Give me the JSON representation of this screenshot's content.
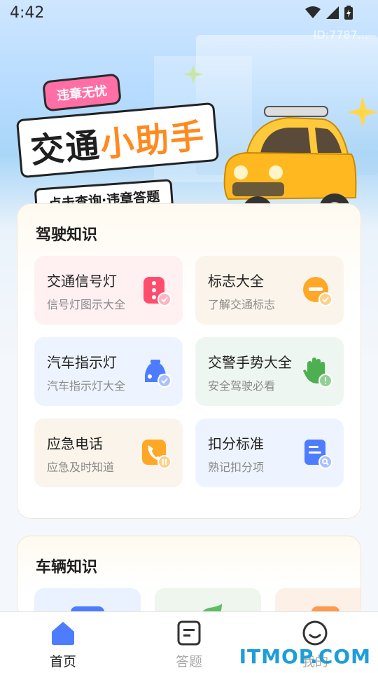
{
  "status": {
    "time": "4:42"
  },
  "user": {
    "id_text": "ID:7787..."
  },
  "banner": {
    "badge": "违章无忧",
    "title_main": "交通",
    "title_accent": "小助手",
    "subtitle": "点击查询·违章答题"
  },
  "driving": {
    "title": "驾驶知识",
    "items": [
      {
        "title": "交通信号灯",
        "subtitle": "信号灯图示大全",
        "icon": "traffic-light-icon"
      },
      {
        "title": "标志大全",
        "subtitle": "了解交通标志",
        "icon": "sign-icon"
      },
      {
        "title": "汽车指示灯",
        "subtitle": "汽车指示灯大全",
        "icon": "car-indicator-icon"
      },
      {
        "title": "交警手势大全",
        "subtitle": "安全驾驶必看",
        "icon": "hand-gesture-icon"
      },
      {
        "title": "应急电话",
        "subtitle": "应急及时知道",
        "icon": "phone-icon"
      },
      {
        "title": "扣分标准",
        "subtitle": "熟记扣分项",
        "icon": "document-search-icon"
      }
    ]
  },
  "vehicle": {
    "title": "车辆知识"
  },
  "tabs": [
    {
      "label": "首页",
      "icon": "home-icon",
      "active": true
    },
    {
      "label": "答题",
      "icon": "quiz-icon",
      "active": false
    },
    {
      "label": "我的",
      "icon": "profile-icon",
      "active": false
    }
  ],
  "watermark": "ITMOP.COM",
  "colors": {
    "accent": "#4d7cff",
    "orange": "#ff8a1f",
    "pink": "#ff6fa6"
  }
}
